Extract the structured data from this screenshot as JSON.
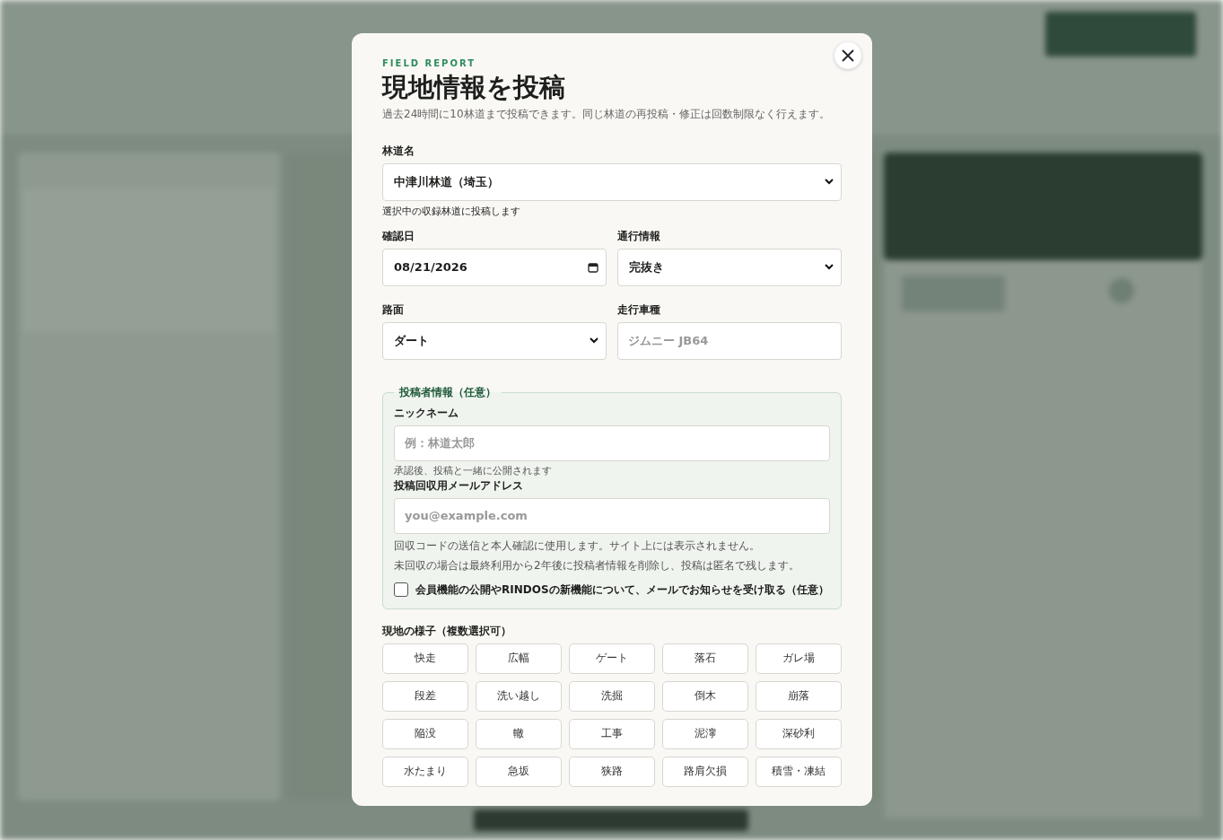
{
  "modal": {
    "eyebrow": "FIELD REPORT",
    "title": "現地情報を投稿",
    "description": "過去24時間に10林道まで投稿できます。同じ林道の再投稿・修正は回数制限なく行えます。",
    "road": {
      "label": "林道名",
      "value": "中津川林道（埼玉）",
      "help": "選択中の収録林道に投稿します"
    },
    "date": {
      "label": "確認日",
      "value": "08/21/2026"
    },
    "passage": {
      "label": "通行情報",
      "value": "完抜き"
    },
    "surface": {
      "label": "路面",
      "value": "ダート"
    },
    "vehicle": {
      "label": "走行車種",
      "placeholder": "ジムニー JB64"
    },
    "poster": {
      "legend": "投稿者情報（任意）",
      "nickname": {
        "label": "ニックネーム",
        "placeholder": "例：林道太郎",
        "help": "承認後、投稿と一緒に公開されます"
      },
      "email": {
        "label": "投稿回収用メールアドレス",
        "placeholder": "you@example.com",
        "help": [
          "回収コードの送信と本人確認に使用します。サイト上には表示されません。",
          "未回収の場合は最終利用から2年後に投稿者情報を削除し、投稿は匿名で残します。"
        ]
      },
      "newsletter": {
        "label": "会員機能の公開やRINDOSの新機能について、メールでお知らせを受け取る（任意）",
        "checked": false
      }
    },
    "conditions": {
      "label": "現地の様子（複数選択可）",
      "options": [
        {
          "label": "快走",
          "selected": false
        },
        {
          "label": "広幅",
          "selected": false
        },
        {
          "label": "ゲート",
          "selected": false
        },
        {
          "label": "落石",
          "selected": false
        },
        {
          "label": "ガレ場",
          "selected": false
        },
        {
          "label": "段差",
          "selected": false
        },
        {
          "label": "洗い越し",
          "selected": false
        },
        {
          "label": "洗掘",
          "selected": false
        },
        {
          "label": "倒木",
          "selected": false
        },
        {
          "label": "崩落",
          "selected": false
        },
        {
          "label": "陥没",
          "selected": false
        },
        {
          "label": "轍",
          "selected": false
        },
        {
          "label": "工事",
          "selected": false
        },
        {
          "label": "泥濘",
          "selected": false
        },
        {
          "label": "深砂利",
          "selected": false
        },
        {
          "label": "水たまり",
          "selected": false
        },
        {
          "label": "急坂",
          "selected": false
        },
        {
          "label": "狭路",
          "selected": false
        },
        {
          "label": "路肩欠損",
          "selected": false
        },
        {
          "label": "積雪・凍結",
          "selected": false
        }
      ]
    }
  }
}
